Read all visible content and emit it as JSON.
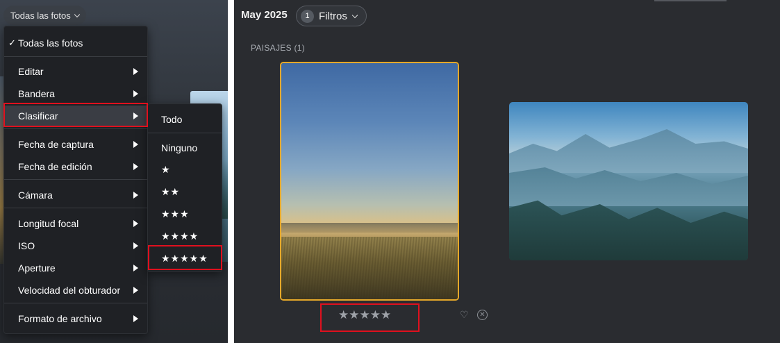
{
  "left": {
    "filter_button": {
      "label": "Todas las fotos"
    },
    "menu": {
      "items": [
        {
          "label": "Todas las fotos",
          "checked": true
        },
        {
          "label": "Editar"
        },
        {
          "label": "Bandera"
        },
        {
          "label": "Clasificar"
        },
        {
          "label": "Fecha de captura"
        },
        {
          "label": "Fecha de edición"
        },
        {
          "label": "Cámara"
        },
        {
          "label": "Longitud focal"
        },
        {
          "label": "ISO"
        },
        {
          "label": "Aperture"
        },
        {
          "label": "Velocidad del obturador"
        },
        {
          "label": "Formato de archivo"
        }
      ]
    },
    "submenu": {
      "items": [
        {
          "label": "Todo"
        },
        {
          "label": "Ninguno"
        },
        {
          "label": "★"
        },
        {
          "label": "★★"
        },
        {
          "label": "★★★"
        },
        {
          "label": "★★★★"
        },
        {
          "label": "★★★★★"
        }
      ]
    }
  },
  "right": {
    "date_title": "May 2025",
    "filters": {
      "count": "1",
      "label": "Filtros"
    },
    "section_label": "PAISAJES (1)",
    "selected_photo": {
      "rating_stars": "★★★★★",
      "rating": 5
    },
    "icons": {
      "heart": "heart-icon",
      "reject": "reject-icon"
    }
  },
  "colors": {
    "highlight": "#e0101e",
    "selected_border": "#e5a82a",
    "menu_bg": "#1f2125",
    "panel_bg": "#2a2c30"
  }
}
